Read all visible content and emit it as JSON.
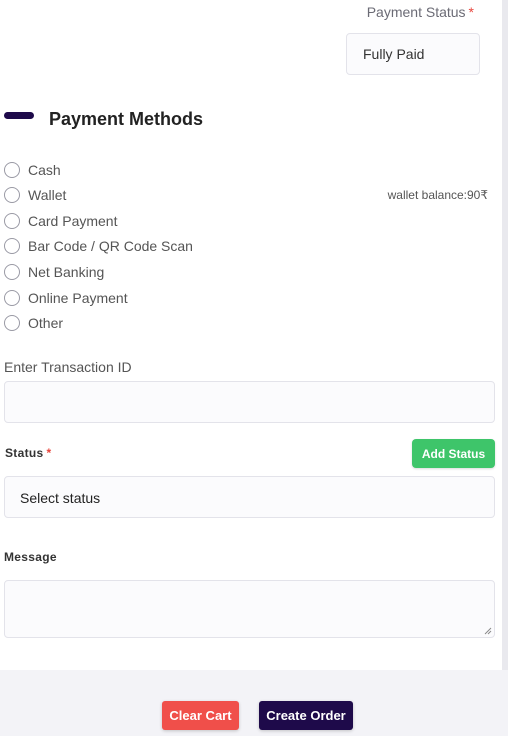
{
  "payment_status": {
    "label": "Payment Status",
    "required_mark": "*",
    "value": "Fully Paid"
  },
  "payment_methods": {
    "title": "Payment Methods",
    "options": [
      "Cash",
      "Wallet",
      "Card Payment",
      "Bar Code / QR Code Scan",
      "Net Banking",
      "Online Payment",
      "Other"
    ],
    "wallet_balance": "wallet balance:90₹"
  },
  "transaction": {
    "label": "Enter Transaction ID",
    "value": ""
  },
  "status": {
    "label": "Status",
    "required_mark": "*",
    "add_button": "Add Status",
    "selected": "Select status"
  },
  "message": {
    "label": "Message",
    "value": ""
  },
  "actions": {
    "clear_cart": "Clear Cart",
    "create_order": "Create Order"
  },
  "colors": {
    "brand_dark": "#1e0a4a",
    "add_green": "#3ec56a",
    "clear_red": "#f04f4a",
    "required_red": "#e8453c"
  }
}
